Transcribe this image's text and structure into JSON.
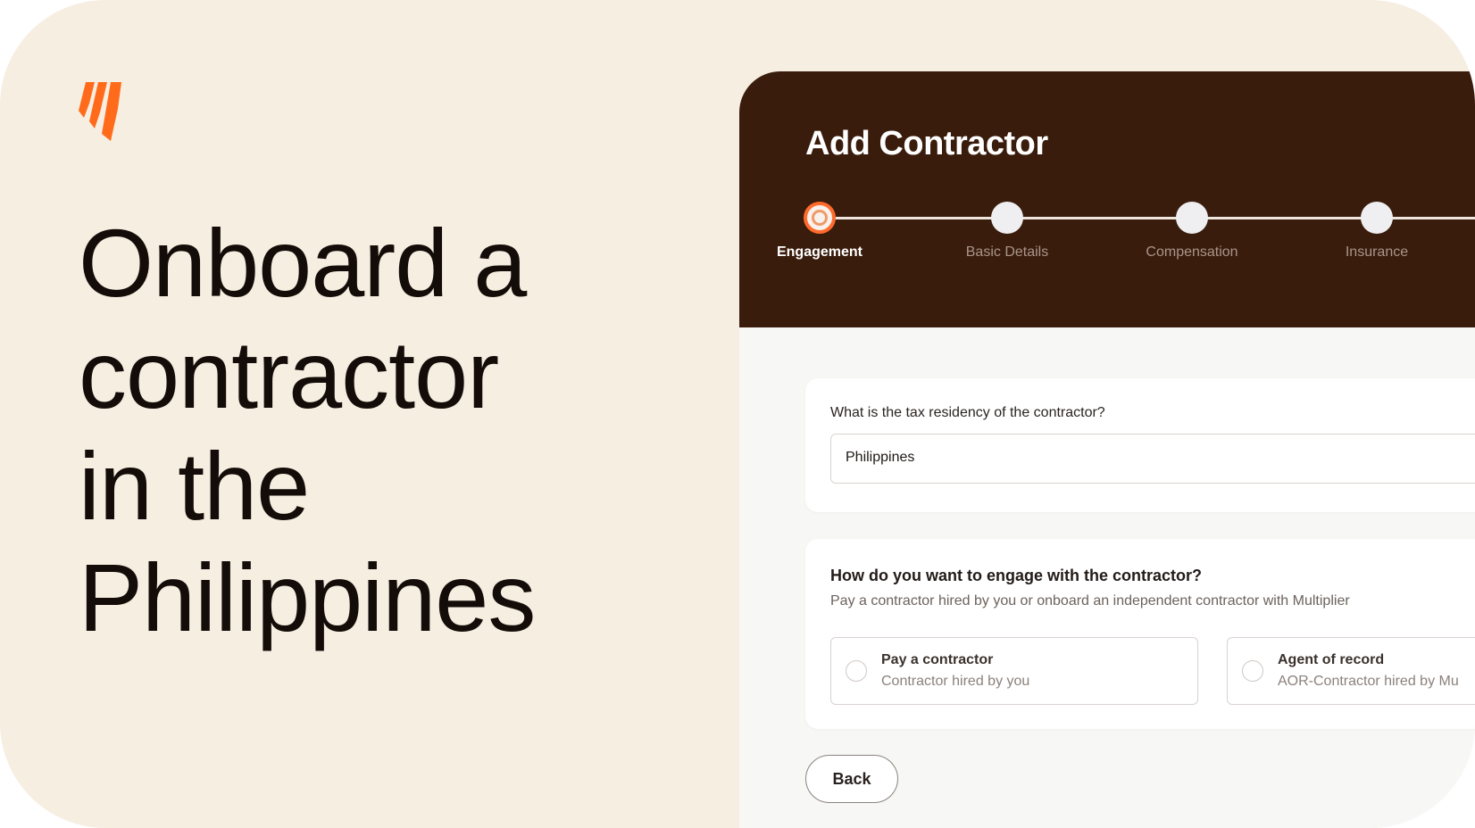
{
  "promo": {
    "headline_lines": [
      "Onboard a",
      "contractor",
      "in the",
      "Philippines"
    ],
    "brand_color": "#ff6b1a"
  },
  "app": {
    "title": "Add Contractor",
    "steps": [
      {
        "label": "Engagement",
        "state": "active"
      },
      {
        "label": "Basic Details",
        "state": "upcoming"
      },
      {
        "label": "Compensation",
        "state": "upcoming"
      },
      {
        "label": "Insurance",
        "state": "upcoming"
      }
    ],
    "tax_residency": {
      "question": "What is the tax residency of the contractor?",
      "value": "Philippines"
    },
    "engagement": {
      "question": "How do you want to engage with the contractor?",
      "subtitle": "Pay a contractor hired by you or onboard an independent contractor with Multiplier",
      "options": [
        {
          "title": "Pay a contractor",
          "subtitle": "Contractor hired by you"
        },
        {
          "title": "Agent of record",
          "subtitle": "AOR-Contractor hired by Mu"
        }
      ]
    },
    "back_label": "Back",
    "colors": {
      "header_bg": "#3a1c0c",
      "accent": "#ff6b2c"
    }
  }
}
